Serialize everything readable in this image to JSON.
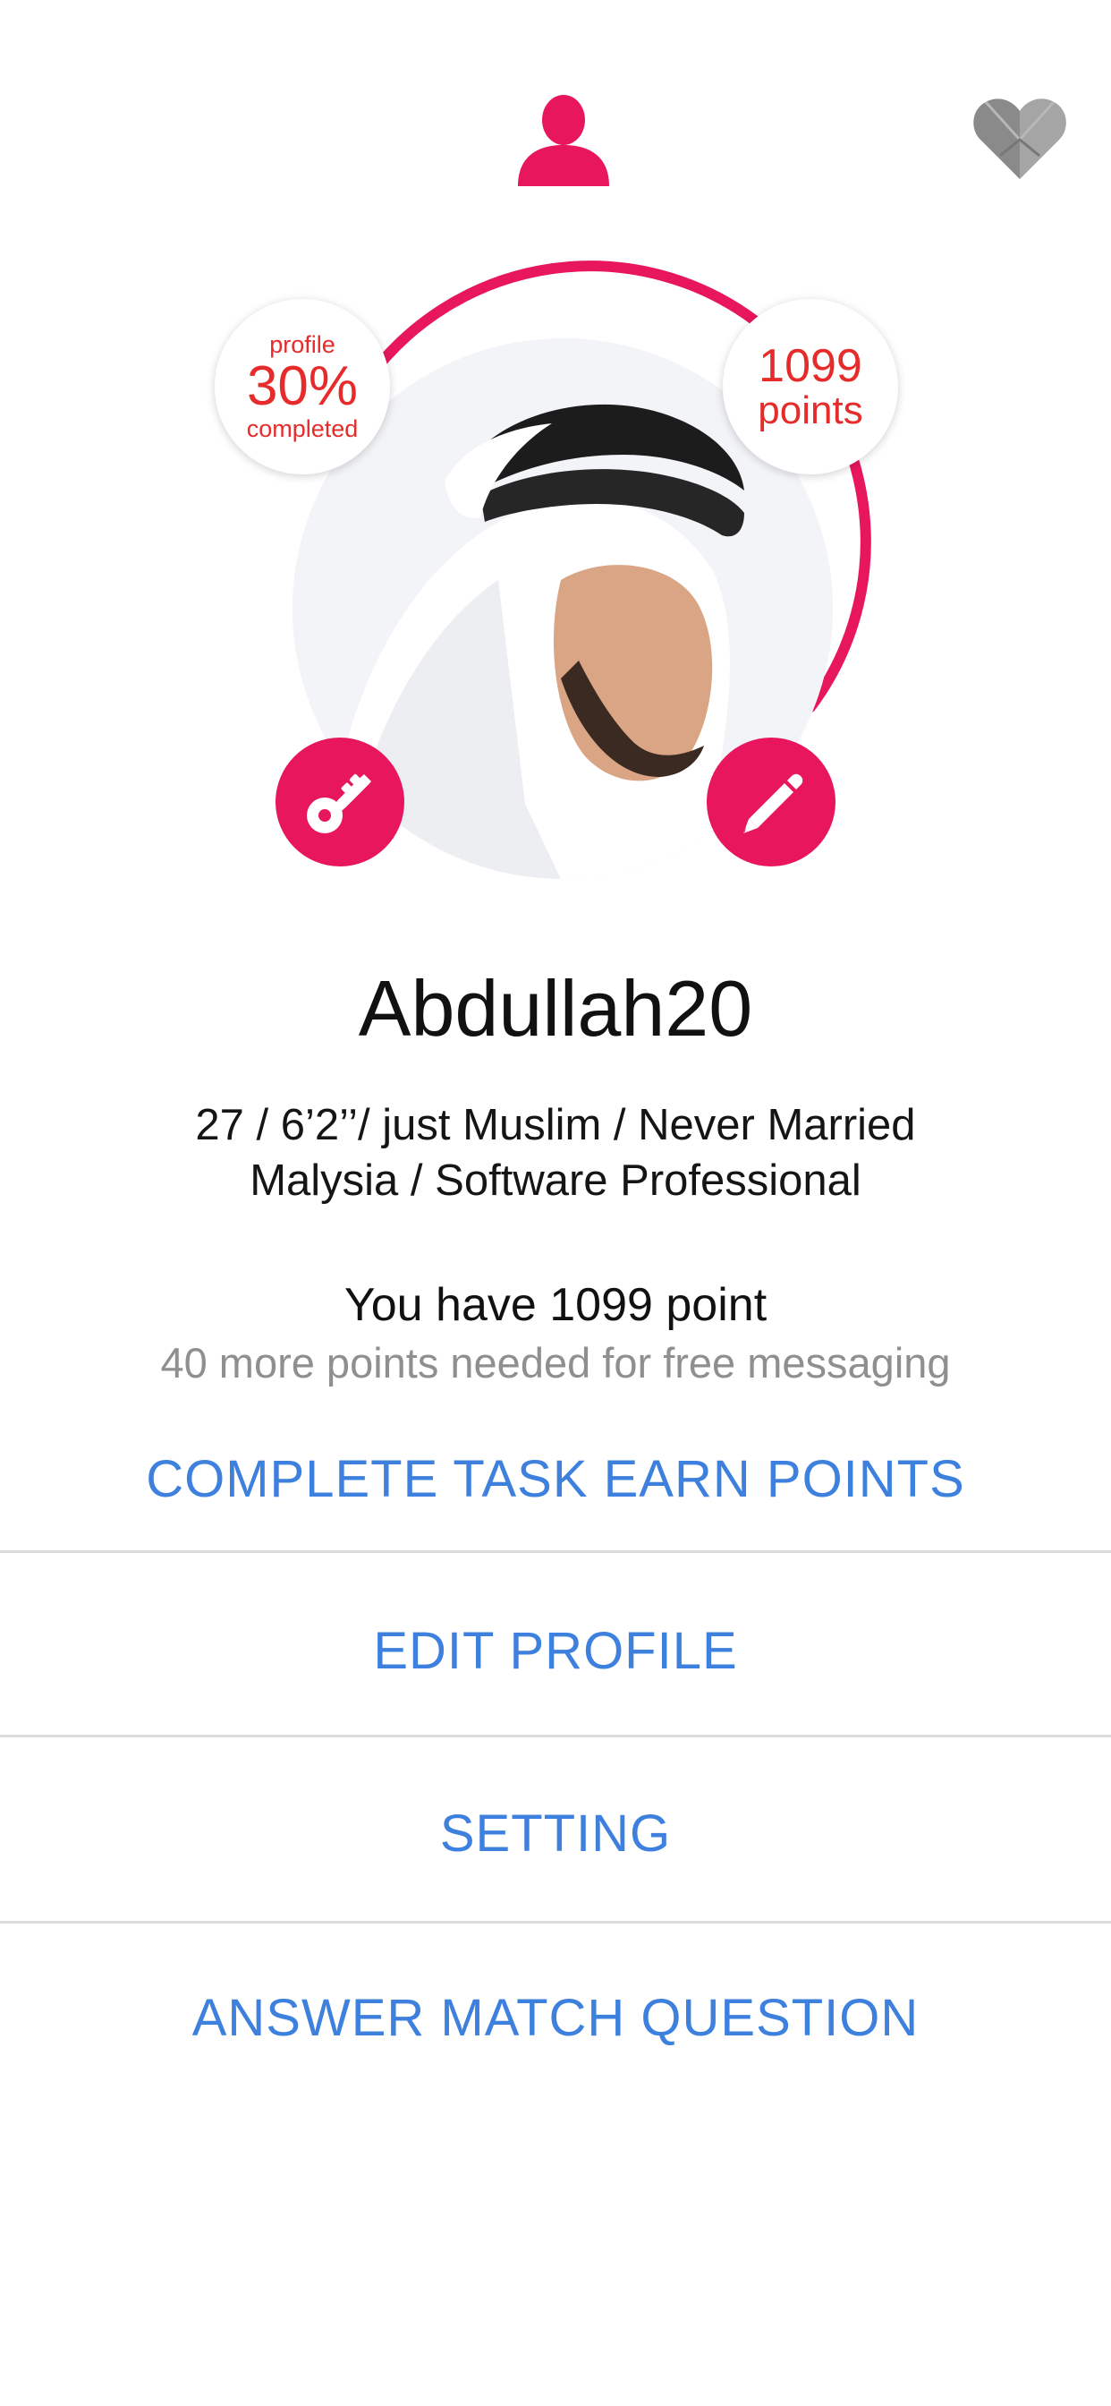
{
  "header": {
    "profile_icon": "person-icon",
    "matches_icon": "heart-icon"
  },
  "profile_card": {
    "completion": {
      "top_label": "profile",
      "percent_text": "30%",
      "bottom_label": "completed",
      "fraction": 0.3
    },
    "points_badge": {
      "value": "1099",
      "unit": "points"
    },
    "avatar_alt": "user profile photo",
    "left_action_icon": "key-icon",
    "right_action_icon": "pencil-icon"
  },
  "user": {
    "username": "Abdullah20",
    "details_line1": "27 / 6’2’’/ just Muslim / Never Married",
    "details_line2": "Malysia / Software Professional"
  },
  "points": {
    "summary": "You have 1099 point",
    "note": "40 more points needed for free messaging"
  },
  "menu": {
    "complete_task": "COMPLETE TASK EARN POINTS",
    "edit_profile": "EDIT PROFILE",
    "setting": "SETTING",
    "answer_match": "ANSWER MATCH QUESTION"
  },
  "colors": {
    "accent": "#e8175d",
    "bubble_text": "#e62b2b",
    "link": "#3d80dd",
    "muted": "#8f8f8f",
    "heart_grey": "#8a8a8a"
  }
}
